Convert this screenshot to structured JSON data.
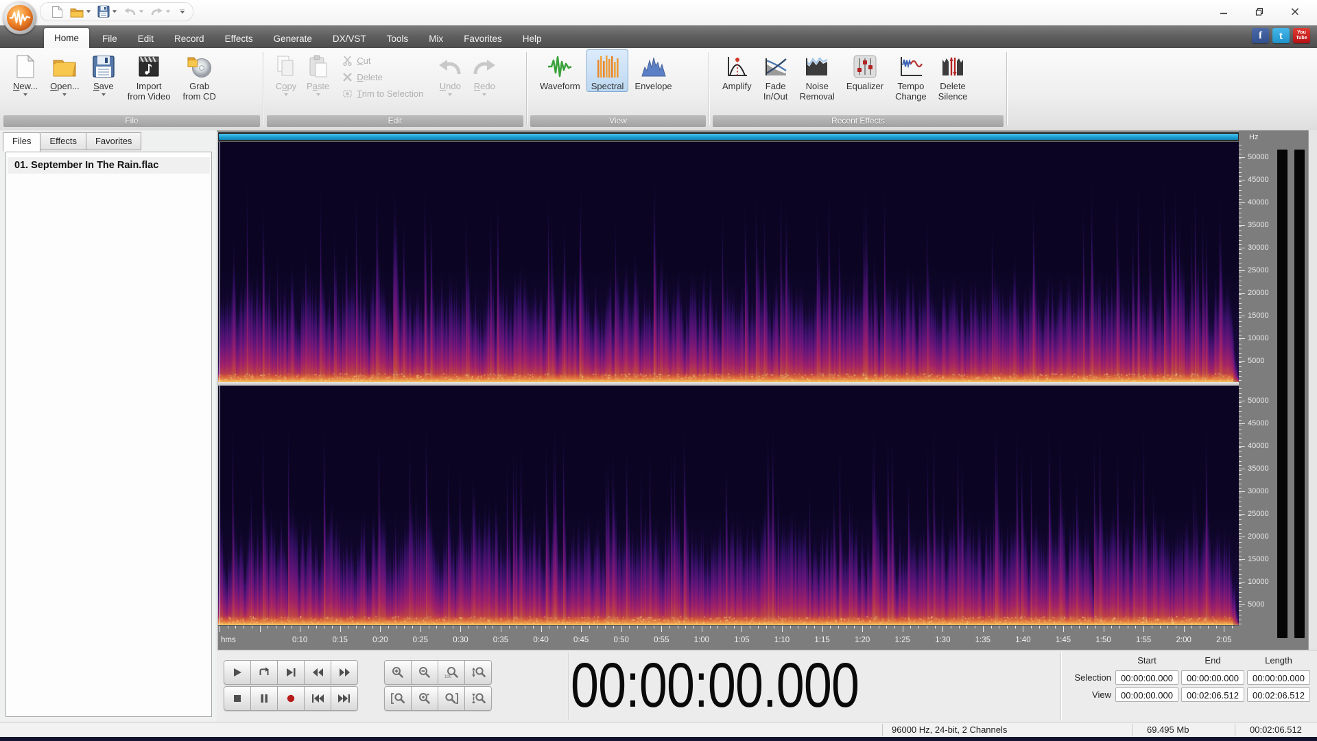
{
  "titlebar": {
    "quick_access": [
      "new-file",
      "open-file",
      "save-file",
      "undo",
      "redo"
    ],
    "window_controls": [
      "minimize",
      "maximize",
      "close"
    ]
  },
  "tabs_bar": {
    "tabs": [
      "Home",
      "File",
      "Edit",
      "Record",
      "Effects",
      "Generate",
      "DX/VST",
      "Tools",
      "Mix",
      "Favorites",
      "Help"
    ],
    "active_tab": "Home",
    "social": {
      "facebook": "f",
      "twitter": "t",
      "youtube_top": "You",
      "youtube_bottom": "Tube"
    }
  },
  "ribbon": {
    "groups": {
      "file": {
        "label": "File",
        "new": "New...",
        "open": "Open...",
        "save": "Save",
        "import_line1": "Import",
        "import_line2": "from Video",
        "grab_line1": "Grab",
        "grab_line2": "from CD"
      },
      "edit": {
        "label": "Edit",
        "copy": "Copy",
        "paste": "Paste",
        "cut": "Cut",
        "del": "Delete",
        "trim": "Trim to Selection",
        "undo": "Undo",
        "redo": "Redo"
      },
      "view": {
        "label": "View",
        "waveform": "Waveform",
        "spectral": "Spectral",
        "envelope": "Envelope",
        "selected": "Spectral"
      },
      "effects": {
        "label": "Recent Effects",
        "amplify": "Amplify",
        "fade_line1": "Fade",
        "fade_line2": "In/Out",
        "noise_line1": "Noise",
        "noise_line2": "Removal",
        "equalizer": "Equalizer",
        "tempo_line1": "Tempo",
        "tempo_line2": "Change",
        "silence_line1": "Delete",
        "silence_line2": "Silence"
      }
    }
  },
  "sidebar": {
    "tabs": [
      "Files",
      "Effects",
      "Favorites"
    ],
    "active_tab": "Files",
    "files": [
      "01. September In The Rain.flac"
    ]
  },
  "spectrogram": {
    "channels": 2,
    "view_mode": "Spectral"
  },
  "freq_axis": {
    "unit": "Hz",
    "labels": [
      "50000",
      "45000",
      "40000",
      "35000",
      "30000",
      "25000",
      "20000",
      "15000",
      "10000",
      "5000"
    ]
  },
  "timeline": {
    "unit": "hms",
    "duration_seconds": 126.512,
    "labels": [
      {
        "t": 10,
        "text": "0:10"
      },
      {
        "t": 15,
        "text": "0:15"
      },
      {
        "t": 20,
        "text": "0:20"
      },
      {
        "t": 25,
        "text": "0:25"
      },
      {
        "t": 30,
        "text": "0:30"
      },
      {
        "t": 35,
        "text": "0:35"
      },
      {
        "t": 40,
        "text": "0:40"
      },
      {
        "t": 45,
        "text": "0:45"
      },
      {
        "t": 50,
        "text": "0:50"
      },
      {
        "t": 55,
        "text": "0:55"
      },
      {
        "t": 60,
        "text": "1:00"
      },
      {
        "t": 65,
        "text": "1:05"
      },
      {
        "t": 70,
        "text": "1:10"
      },
      {
        "t": 75,
        "text": "1:15"
      },
      {
        "t": 80,
        "text": "1:20"
      },
      {
        "t": 85,
        "text": "1:25"
      },
      {
        "t": 90,
        "text": "1:30"
      },
      {
        "t": 95,
        "text": "1:35"
      },
      {
        "t": 100,
        "text": "1:40"
      },
      {
        "t": 105,
        "text": "1:45"
      },
      {
        "t": 110,
        "text": "1:50"
      },
      {
        "t": 115,
        "text": "1:55"
      },
      {
        "t": 120,
        "text": "2:00"
      },
      {
        "t": 125,
        "text": "2:05"
      }
    ]
  },
  "transport": {
    "row1": [
      "play",
      "loop",
      "play-to-end",
      "rewind",
      "fast-forward"
    ],
    "row2": [
      "stop",
      "pause",
      "record",
      "go-to-start",
      "go-to-end"
    ]
  },
  "zoom_controls": {
    "row1": [
      "zoom-in",
      "zoom-out",
      "zoom-100",
      "zoom-vertical-in"
    ],
    "row2": [
      "zoom-selection-start",
      "zoom-selection",
      "zoom-selection-end",
      "zoom-vertical-out"
    ]
  },
  "time_display": "00:00:00.000",
  "selection_grid": {
    "headers": [
      "Start",
      "End",
      "Length"
    ],
    "rows": [
      {
        "label": "Selection",
        "values": [
          "00:00:00.000",
          "00:00:00.000",
          "00:00:00.000"
        ]
      },
      {
        "label": "View",
        "values": [
          "00:00:00.000",
          "00:02:06.512",
          "00:02:06.512"
        ]
      }
    ]
  },
  "status_bar": {
    "format": "96000 Hz, 24-bit, 2 Channels",
    "file_size": "69.495 Mb",
    "length": "00:02:06.512"
  },
  "colors": {
    "record_red": "#b71c1c",
    "selected_view_bg": "#cfe2f6",
    "scrollbar_cyan": "#1d9fd4",
    "tabstrip_gray": "#5a5a5a",
    "spectrogram_bg": "#0b0523"
  }
}
